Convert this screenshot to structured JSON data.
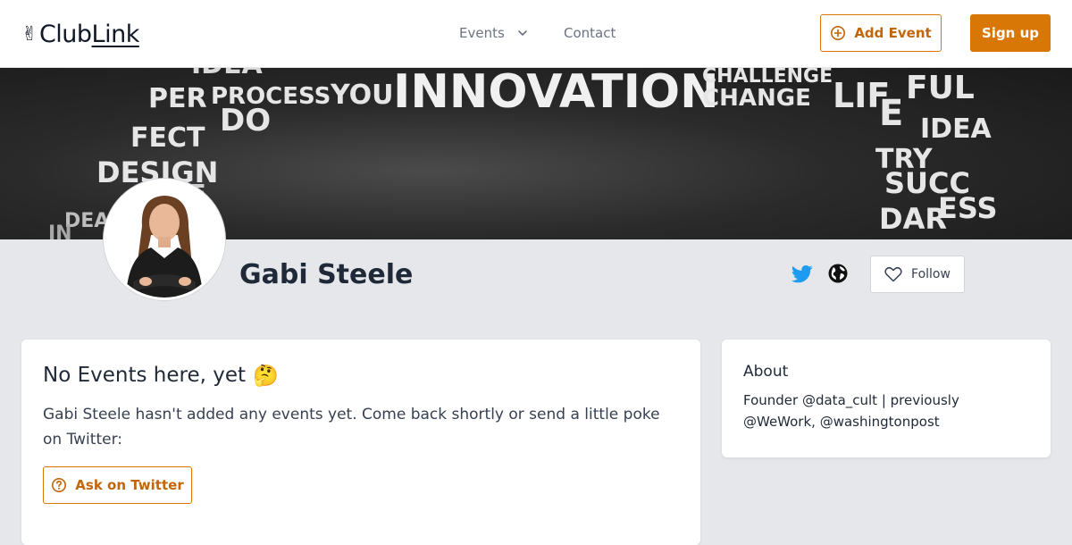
{
  "header": {
    "logo_emoji": "✌",
    "logo_text_1": "Club",
    "logo_text_2": "Link",
    "nav_events": "Events",
    "nav_contact": "Contact",
    "add_event_label": "Add Event",
    "signup_label": "Sign up"
  },
  "banner": {
    "words": [
      "IDEA",
      "PER",
      "PROCESS",
      "YOU",
      "INNOVATION",
      "CHALLENGE",
      "CHANGE",
      "LIF",
      "FUL",
      "DO",
      "FECT",
      "DESIGN",
      "E",
      "IDEA",
      "TRY",
      "SUCC",
      "ESS",
      "DAR",
      "DEA",
      "IN",
      "VE"
    ]
  },
  "profile": {
    "name": "Gabi Steele",
    "follow_label": "Follow"
  },
  "events_card": {
    "title": "No Events here, yet",
    "title_emoji": "🤔",
    "description": "Gabi Steele hasn't added any events yet. Come back shortly or send a little poke on Twitter:",
    "ask_label": "Ask on Twitter"
  },
  "about_card": {
    "title": "About",
    "text": "Founder @data_cult | previously @WeWork, @washingtonpost"
  },
  "colors": {
    "accent": "#d97706",
    "twitter": "#1d9bf0",
    "background": "#e5e7eb"
  },
  "icons": {
    "add_event": "plus-circle-icon",
    "events_dropdown": "chevron-down-icon",
    "twitter": "twitter-icon",
    "website": "globe-icon",
    "follow": "heart-icon",
    "ask": "question-circle-icon"
  }
}
